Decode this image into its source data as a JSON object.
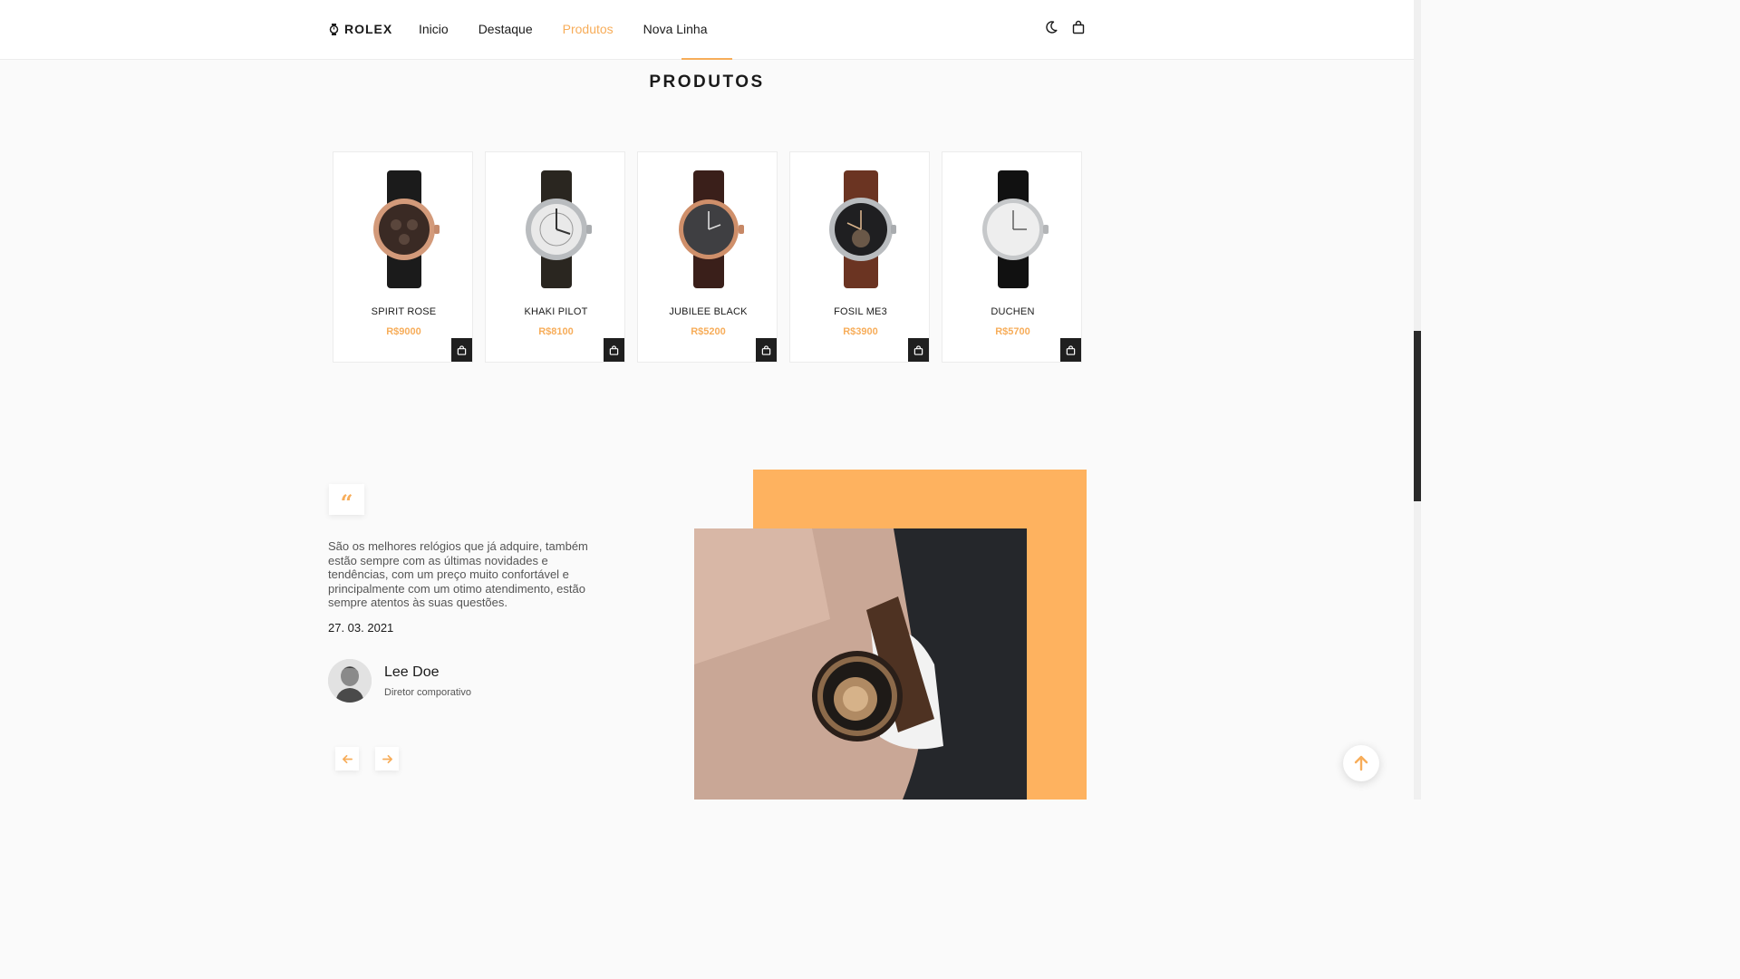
{
  "header": {
    "logo_text": "ROLEX",
    "nav": [
      {
        "label": "Inicio",
        "active": false
      },
      {
        "label": "Destaque",
        "active": false
      },
      {
        "label": "Produtos",
        "active": true
      },
      {
        "label": "Nova Linha",
        "active": false
      }
    ],
    "icons": [
      "moon-icon",
      "shopping-bag-icon"
    ]
  },
  "products_section": {
    "title": "PRODUTOS",
    "items": [
      {
        "name": "SPIRIT ROSE",
        "price": "R$9000"
      },
      {
        "name": "KHAKI PILOT",
        "price": "R$8100"
      },
      {
        "name": "JUBILEE BLACK",
        "price": "R$5200"
      },
      {
        "name": "FOSIL ME3",
        "price": "R$3900"
      },
      {
        "name": "DUCHEN",
        "price": "R$5700"
      }
    ]
  },
  "testimonial": {
    "quote_mark": "“",
    "text": "São os melhores relógios que já adquire, também estão sempre com as últimas novidades e tendências, com um preço muito confortável e principalmente com um otimo atendimento, estão sempre atentos às suas questões.",
    "date": "27. 03. 2021",
    "person_name": "Lee Doe",
    "person_role": "Diretor comporativo"
  },
  "colors": {
    "accent": "#f7ad5a",
    "accent_block": "#feb25f",
    "dark": "#1f1f1f"
  }
}
